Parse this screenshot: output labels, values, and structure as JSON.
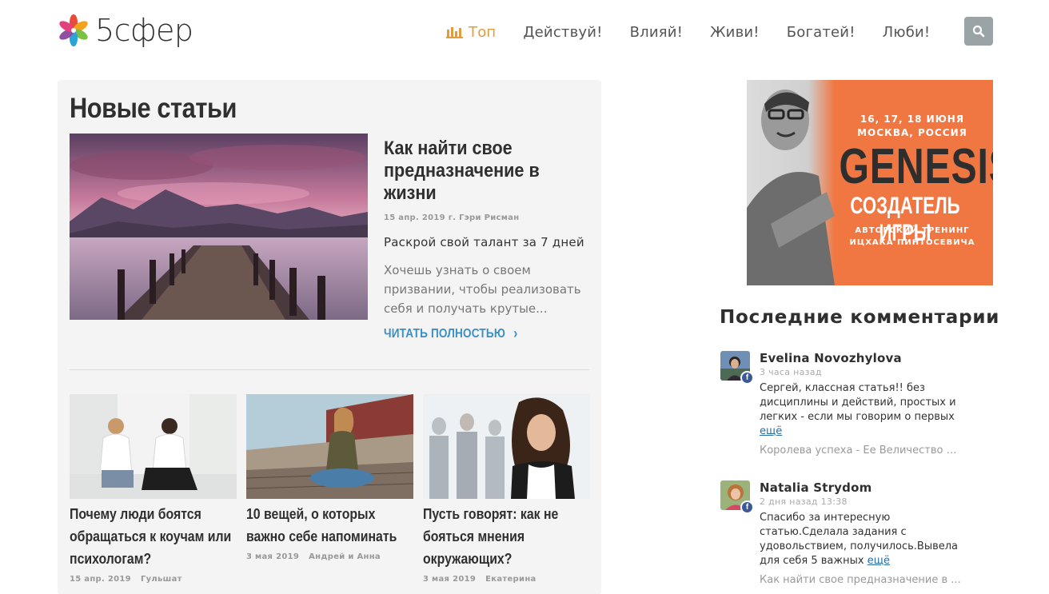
{
  "header": {
    "logo_text": "5сфер",
    "nav": [
      {
        "label": "Топ",
        "icon": "bar-chart-icon",
        "active": true
      },
      {
        "label": "Действуй!"
      },
      {
        "label": "Влияй!"
      },
      {
        "label": "Живи!"
      },
      {
        "label": "Богатей!"
      },
      {
        "label": "Люби!"
      }
    ],
    "search_icon": "search-icon"
  },
  "colors": {
    "accent": "#e49b3c",
    "link": "#3a8fc6",
    "panel_bg": "#f4f4f4",
    "ad_bg": "#f07642",
    "facebook": "#3b5998"
  },
  "main": {
    "section_title": "Новые статьи",
    "featured": {
      "title": "Как найти свое предназначение в жизни",
      "date": "15 апр. 2019 г.",
      "author": "Гэри Рисман",
      "subtitle": "Раскрой свой талант за 7 дней",
      "excerpt": "Хочешь узнать о своем призвании, чтобы реализовать себя и получать крутые...",
      "read_more": "ЧИТАТЬ ПОЛНОСТЬЮ"
    },
    "cards": [
      {
        "title": "Почему люди боятся обращаться к коучам или психологам?",
        "date": "15 апр. 2019",
        "author": "Гульшат"
      },
      {
        "title": "10 вещей, о которых важно себе напоминать",
        "date": "3 мая 2019",
        "author": "Андрей и Анна"
      },
      {
        "title": "Пусть говорят: как не бояться мнения окружающих?",
        "date": "3 мая 2019",
        "author": "Екатерина"
      }
    ]
  },
  "ad": {
    "date_line1": "16, 17, 18 ИЮНЯ",
    "date_line2": "МОСКВА, РОССИЯ",
    "headline": "GENESIS",
    "subheadline": "СОЗДАТЕЛЬ ИГРЫ",
    "author_line1": "АВТОРСКИЙ ТРЕНИНГ",
    "author_line2": "ИЦХАКА ПИНТОСЕВИЧА"
  },
  "comments": {
    "title": "Последние комментарии",
    "items": [
      {
        "author": "Evelina Novozhylova",
        "time": "3 часа назад",
        "text": "Сергей, классная статья!! без дисциплины и действий, простых и легких - если мы говорим о первых",
        "more": "ещё",
        "source": "Королева успеха - Ее Величество Д..."
      },
      {
        "author": "Natalia Strydom",
        "time": "2 дня назад 13:38",
        "text": "Спасибо за интересную статью.Сделала задания с удовольствием, получилось.Вывела для себя 5 важных",
        "more": "ещё",
        "source": "Как найти свое предназначение в ..."
      }
    ]
  }
}
